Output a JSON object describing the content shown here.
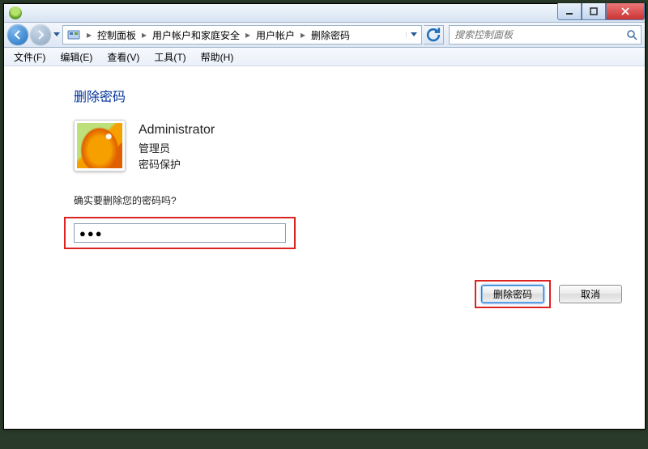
{
  "breadcrumbs": {
    "items": [
      {
        "label": "控制面板"
      },
      {
        "label": "用户帐户和家庭安全"
      },
      {
        "label": "用户帐户"
      },
      {
        "label": "删除密码"
      }
    ]
  },
  "search": {
    "placeholder": "搜索控制面板"
  },
  "menu": {
    "file": "文件(F)",
    "edit": "编辑(E)",
    "view": "查看(V)",
    "tools": "工具(T)",
    "help": "帮助(H)"
  },
  "page": {
    "title": "删除密码",
    "prompt": "确实要删除您的密码吗?"
  },
  "account": {
    "name": "Administrator",
    "role": "管理员",
    "status": "密码保护"
  },
  "password": {
    "value": "●●●"
  },
  "buttons": {
    "remove": "删除密码",
    "cancel": "取消"
  }
}
